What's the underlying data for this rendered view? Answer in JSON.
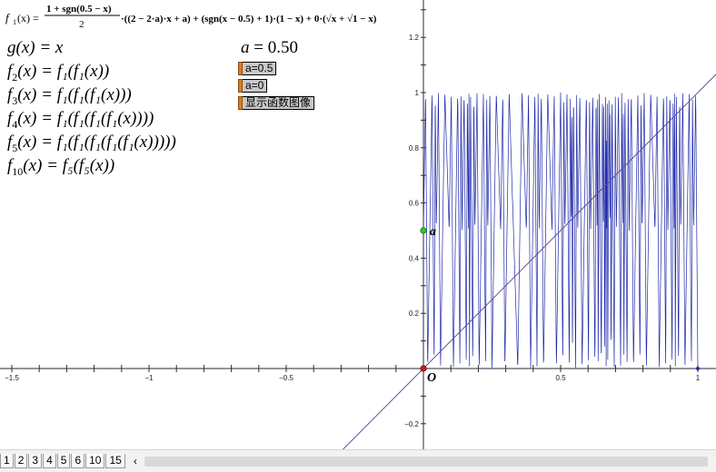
{
  "formula": {
    "lhs": "f",
    "lhs_sub": "1",
    "lhs_arg": "(x) =",
    "frac_num": "1 + sgn(0.5 − x)",
    "frac_den": "2",
    "body": "·((2 − 2·a)·x + a) + (sgn(x − 0.5) + 1)·(1 − x) + 0·(√x + √1 − x)"
  },
  "definitions": [
    {
      "name": "g",
      "sub": "",
      "expr": "(x) = x"
    },
    {
      "name": "f",
      "sub": "2",
      "expr": "(x) = f₁(f₁(x))"
    },
    {
      "name": "f",
      "sub": "3",
      "expr": "(x) = f₁(f₁(f₁(x)))"
    },
    {
      "name": "f",
      "sub": "4",
      "expr": "(x) = f₁(f₁(f₁(f₁(x))))"
    },
    {
      "name": "f",
      "sub": "5",
      "expr": "(x) = f₁(f₁(f₁(f₁(f₁(x)))))"
    },
    {
      "name": "f",
      "sub": "10",
      "expr": "(x) = f₅(f₅(x))"
    }
  ],
  "parameter": {
    "name": "a",
    "eq": " = ",
    "value": "0.50"
  },
  "buttons": {
    "a05": "a=0.5",
    "a0": "a=0",
    "show": "显示函数图像"
  },
  "graph": {
    "x_ticks": [
      "−1.5",
      "−1",
      "−0.5",
      "0.5",
      "1"
    ],
    "y_ticks": [
      "1.2",
      "1",
      "0.8",
      "0.6",
      "0.4",
      "0.2",
      "−0.2"
    ],
    "origin_label": "O",
    "point_label": "a",
    "curve_color": "#1f2aa8",
    "line_color": "#6a4a9a",
    "axis_color": "#2a2a3a",
    "point_color": "#2ec82e",
    "origin_color": "#c81e1e"
  },
  "page_tabs": [
    "1",
    "2",
    "3",
    "4",
    "5",
    "6",
    "10",
    "15"
  ],
  "active_tab": "10"
}
